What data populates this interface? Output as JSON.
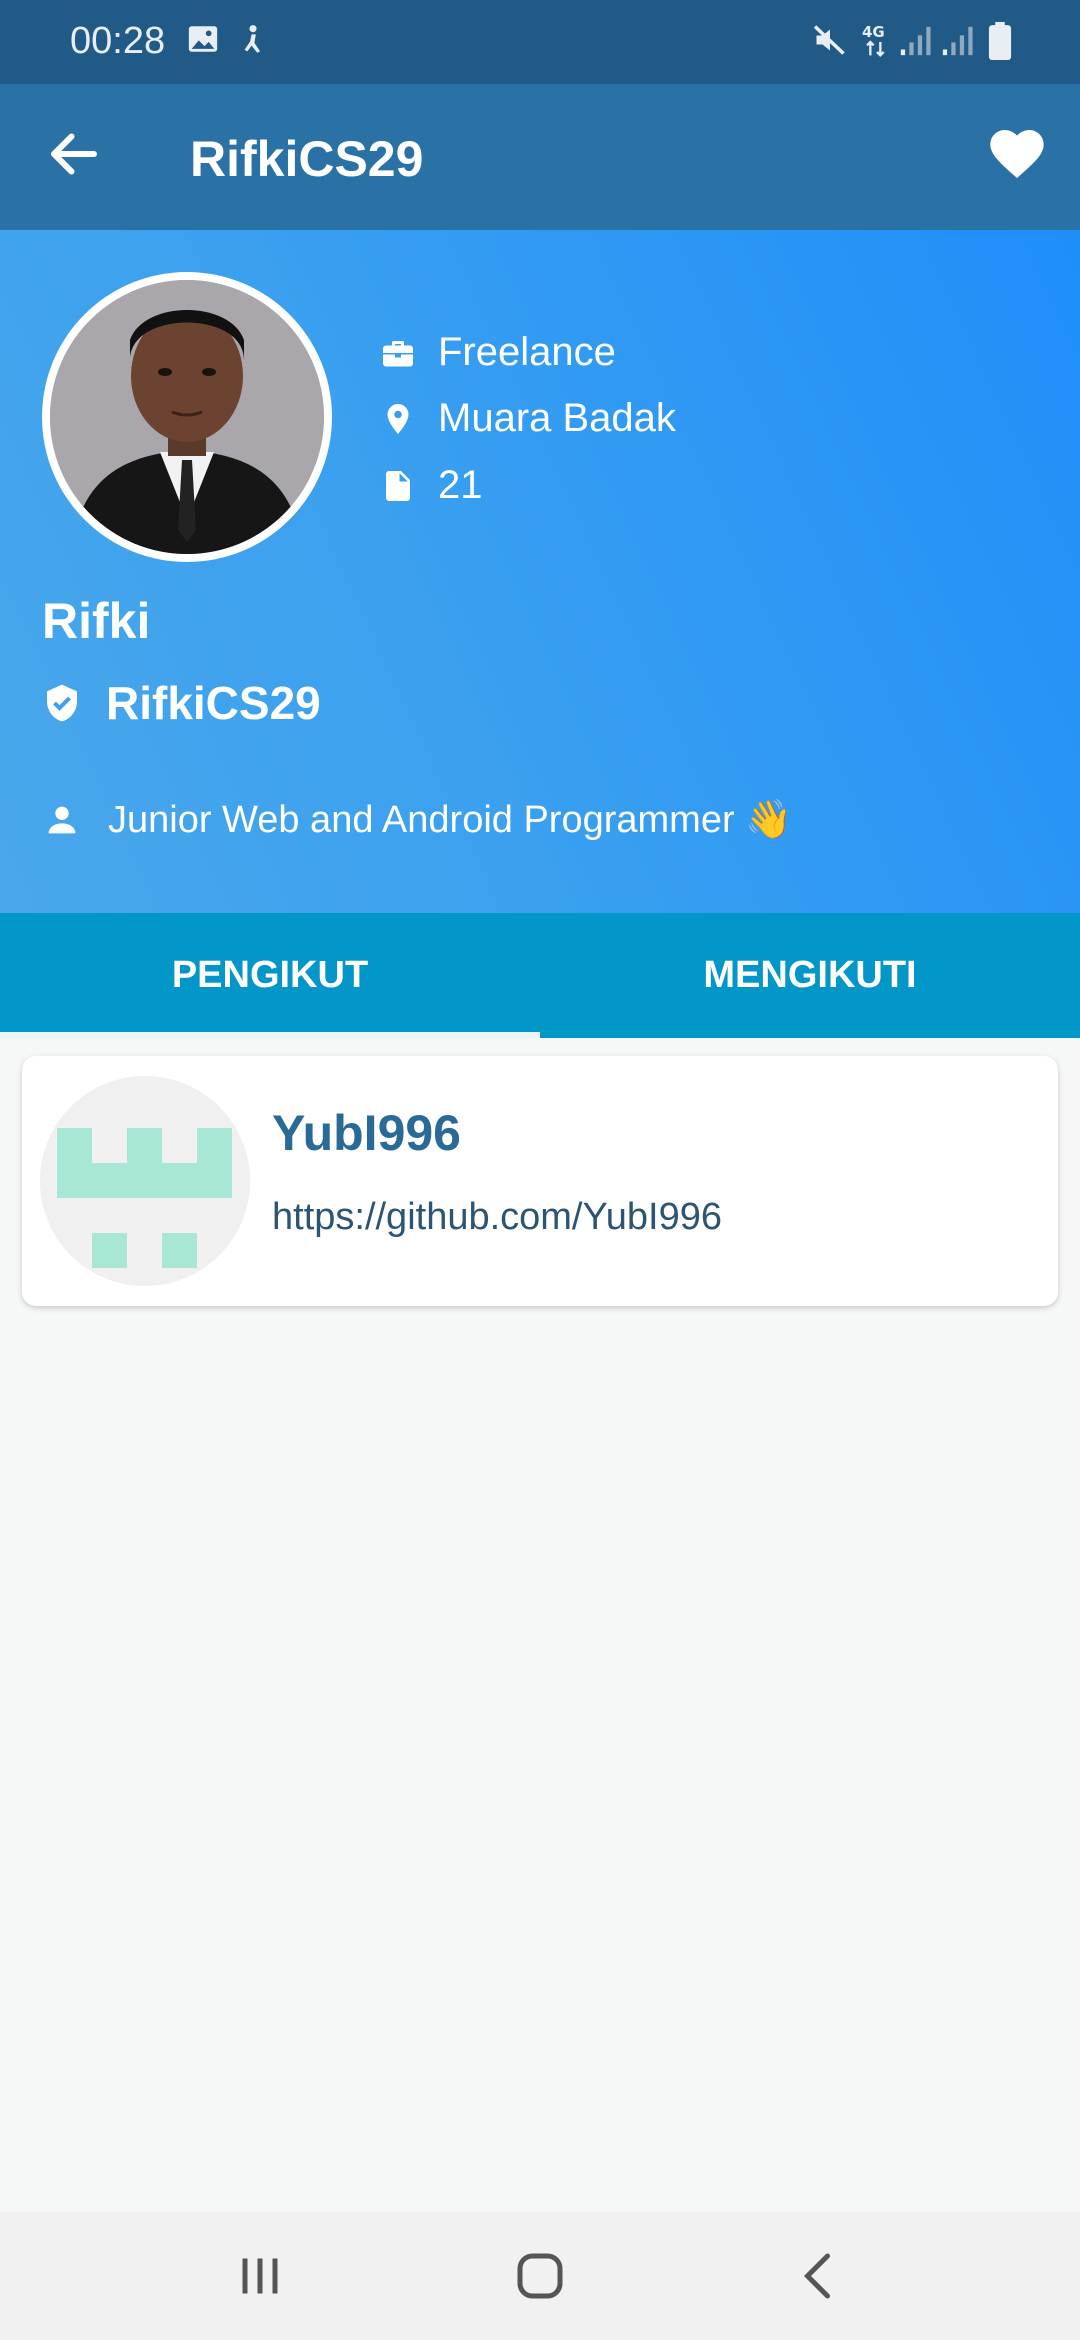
{
  "status_bar": {
    "time": "00:28",
    "icons": [
      "image-icon",
      "accessibility-icon",
      "mute-icon",
      "4g-icon",
      "signal-icon",
      "signal-icon",
      "battery-icon"
    ]
  },
  "app_bar": {
    "title": "RifkiCS29",
    "back_icon": "arrow-left-icon",
    "favorite_icon": "heart-icon"
  },
  "profile": {
    "company": "Freelance",
    "location": "Muara Badak",
    "repositories": "21",
    "name": "Rifki",
    "username": "RifkiCS29",
    "bio": "Junior Web and Android Programmer 👋"
  },
  "tabs": [
    {
      "label": "PENGIKUT",
      "active": true
    },
    {
      "label": "MENGIKUTI",
      "active": false
    }
  ],
  "followers": [
    {
      "username": "YubI996",
      "url": "https://github.com/YubI996"
    }
  ],
  "nav_bar": {
    "buttons": [
      "recents-icon",
      "home-icon",
      "back-icon"
    ]
  },
  "colors": {
    "status_bar": "#215a87",
    "app_bar": "#2a72a6",
    "header_gradient_start": "#4aa7ea",
    "header_gradient_end": "#1f8ef9",
    "tabs": "#0396c8",
    "identicon": "#a8e6d6"
  }
}
